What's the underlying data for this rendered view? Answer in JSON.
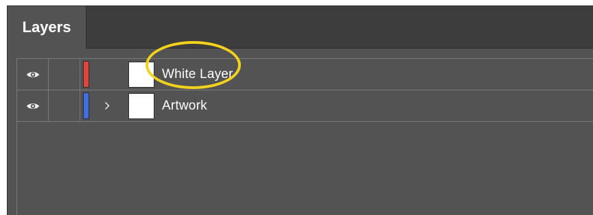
{
  "panel": {
    "tab_label": "Layers"
  },
  "layers": [
    {
      "name": "White Layer",
      "color": "#e0453b",
      "visible": true,
      "has_children": false
    },
    {
      "name": "Artwork",
      "color": "#3d6fe0",
      "visible": true,
      "has_children": true
    }
  ],
  "annotation": {
    "highlight_color": "#f2d21c",
    "target": "White Layer"
  }
}
